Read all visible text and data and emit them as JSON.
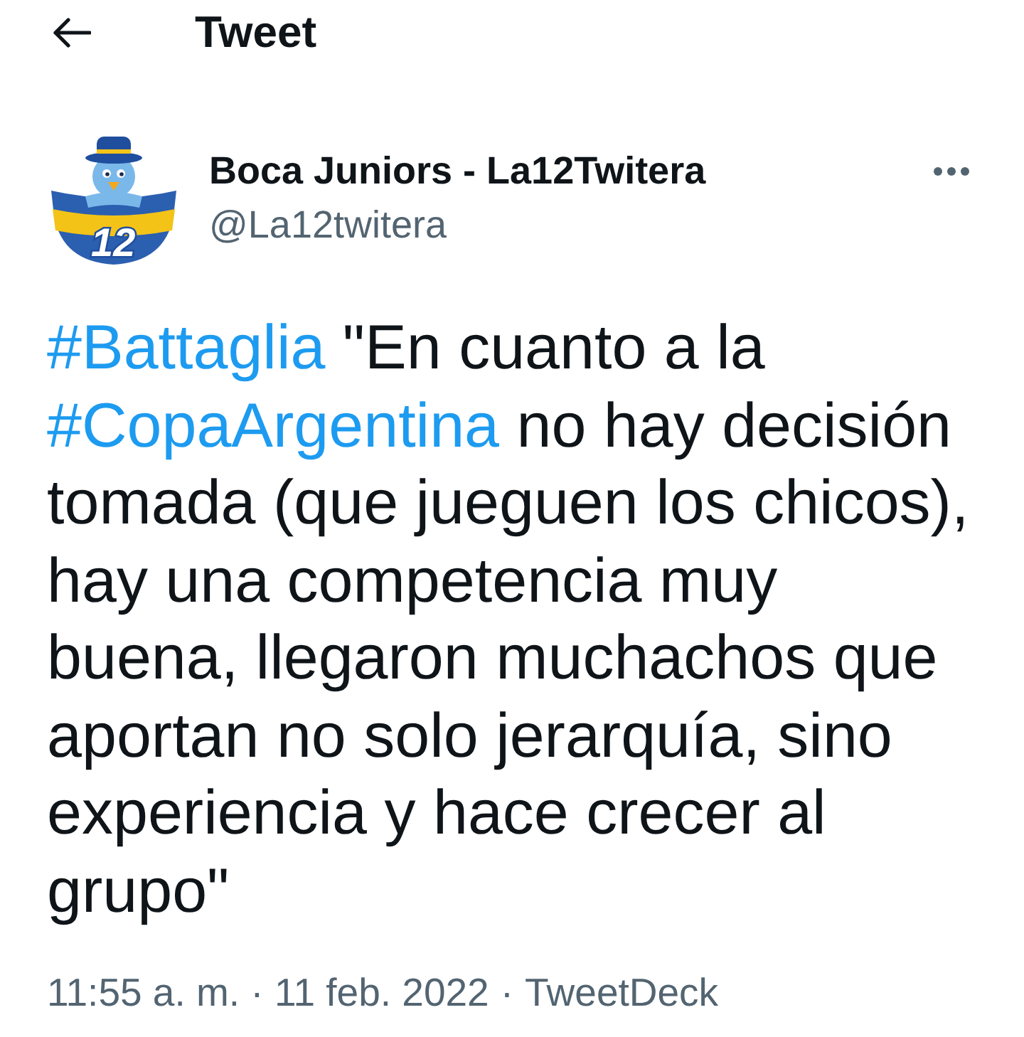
{
  "header": {
    "title": "Tweet"
  },
  "author": {
    "avatar_number": "12",
    "name": "Boca Juniors - La12Twitera",
    "handle": "@La12twitera"
  },
  "tweet": {
    "segments": [
      {
        "kind": "hashtag",
        "text": "#Battaglia"
      },
      {
        "kind": "text",
        "text": " \"En cuanto a la "
      },
      {
        "kind": "hashtag",
        "text": "#CopaArgentina"
      },
      {
        "kind": "text",
        "text": " no hay decisión tomada (que jueguen los chicos), hay una competencia muy buena, llegaron muchachos que aportan no solo jerarquía, sino experiencia y hace crecer al grupo\""
      }
    ]
  },
  "meta": {
    "timestamp": "11:55 a. m. · 11 feb. 2022",
    "separator": "·",
    "source": "TweetDeck"
  }
}
